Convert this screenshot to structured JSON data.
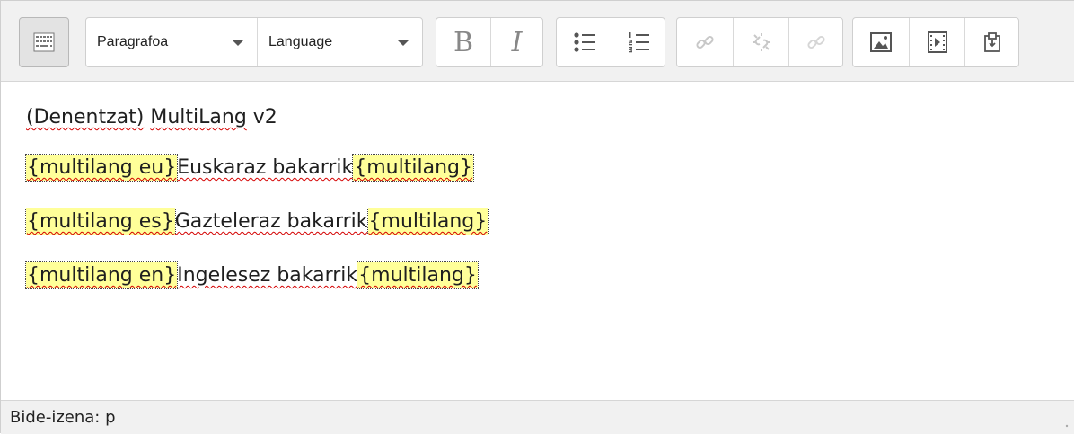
{
  "toolbar": {
    "paragraph_select": {
      "value": "Paragrafoa"
    },
    "language_select": {
      "value": "Language"
    },
    "bold_label": "B",
    "italic_label": "I",
    "icons": {
      "toggle": "toolbar-toggle-icon",
      "unordered_list": "unordered-list-icon",
      "ordered_list": "ordered-list-icon",
      "link": "link-icon",
      "unlink": "unlink-icon",
      "anchor": "anchor-link-icon",
      "image": "image-icon",
      "media": "media-icon",
      "file": "file-manager-icon"
    }
  },
  "content": {
    "heading_line": {
      "words": [
        "(Denentzat)",
        "MultiLang",
        "v2"
      ]
    },
    "lines": [
      {
        "open_tag": "{multilang eu}",
        "text": "Euskaraz bakarrik",
        "close_tag": "{multilang}"
      },
      {
        "open_tag": "{multilang es}",
        "text": "Gazteleraz bakarrik",
        "close_tag": "{multilang}"
      },
      {
        "open_tag": "{multilang en}",
        "text": "Ingelesez bakarrik",
        "close_tag": "{multilang}"
      }
    ]
  },
  "statusbar": {
    "path": "Bide-izena: p"
  },
  "colors": {
    "toolbar_bg": "#f1f1f1",
    "tag_highlight": "#ffff99",
    "spellcheck_underline": "#d40000",
    "disabled_icon": "#c8c8c8"
  }
}
